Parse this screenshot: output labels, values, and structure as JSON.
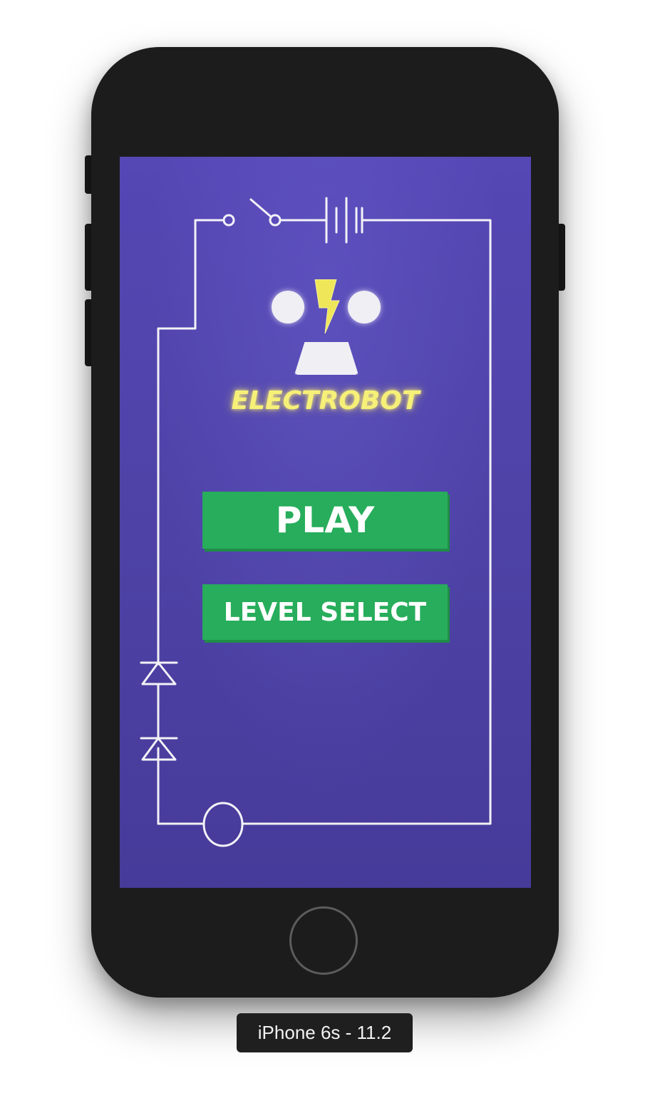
{
  "app": {
    "title": "ELECTROBOT"
  },
  "menu": {
    "play_label": "PLAY",
    "level_select_label": "LEVEL SELECT"
  },
  "simulator": {
    "device_label": "iPhone 6s - 11.2"
  },
  "colors": {
    "background": "#5547b4",
    "button": "#27ad5b",
    "title_glow": "#f6f078",
    "bolt": "#efe65a",
    "circuit_line": "#f2f2f7"
  },
  "icons": {
    "logo_bolt": "lightning-bolt-icon",
    "robot_eyes": "circle",
    "circuit": [
      "switch",
      "battery",
      "diode",
      "diode",
      "lamp"
    ]
  }
}
